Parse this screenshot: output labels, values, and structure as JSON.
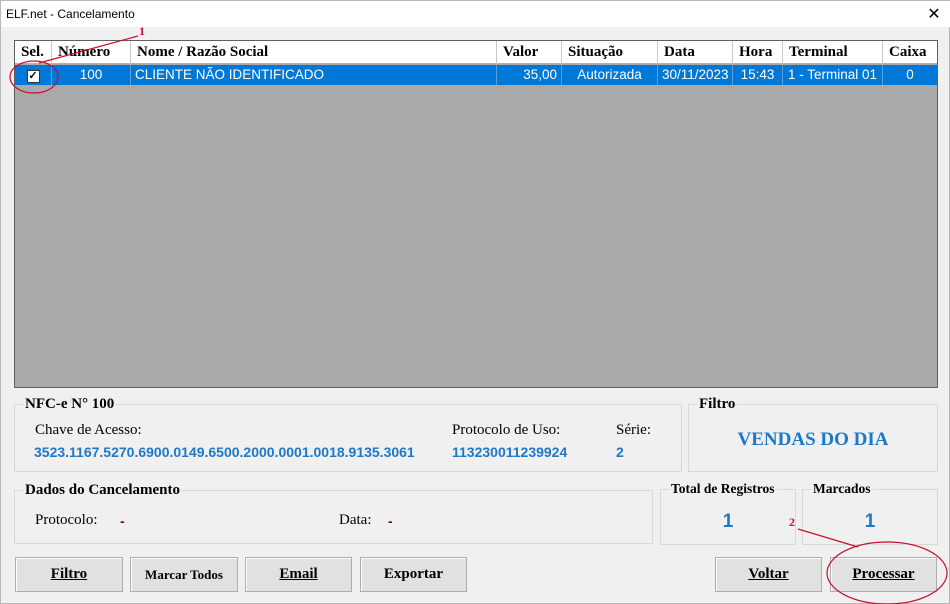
{
  "window": {
    "title": "ELF.net - Cancelamento",
    "close_glyph": "✕"
  },
  "grid": {
    "columns": [
      "Sel.",
      "Número",
      "Nome / Razão Social",
      "Valor",
      "Situação",
      "Data",
      "Hora",
      "Terminal",
      "Caixa"
    ],
    "rows": [
      {
        "selected": true,
        "check_glyph": "✓",
        "numero": "100",
        "nome": "CLIENTE NÃO IDENTIFICADO",
        "valor": "35,00",
        "situacao": "Autorizada",
        "data": "30/11/2023",
        "hora": "15:43",
        "terminal": "1 - Terminal 01",
        "caixa": "0"
      }
    ]
  },
  "nfce": {
    "title": "NFC-e N° 100",
    "chave_label": "Chave de Acesso:",
    "chave_value": "3523.1167.5270.6900.0149.6500.2000.0001.0018.9135.3061",
    "protocolo_label": "Protocolo de Uso:",
    "protocolo_value": "113230011239924",
    "serie_label": "Série:",
    "serie_value": "2"
  },
  "filtro": {
    "title": "Filtro",
    "value": "VENDAS DO DIA"
  },
  "cancelamento": {
    "title": "Dados do Cancelamento",
    "protocolo_label": "Protocolo:",
    "protocolo_value": "-",
    "data_label": "Data:",
    "data_value": "-"
  },
  "totals": {
    "total_label": "Total de Registros",
    "total_value": "1",
    "marcados_label": "Marcados",
    "marcados_value": "1"
  },
  "buttons": {
    "filtro": "Filtro",
    "marcar_todos": "Marcar Todos",
    "email": "Email",
    "exportar": "Exportar",
    "voltar": "Voltar",
    "processar": "Processar"
  },
  "annotations": {
    "marker_1": "1",
    "marker_2": "2",
    "color": "#c8102e"
  },
  "colors": {
    "selection": "#0078d7",
    "grid_bg": "#a9a9a9",
    "value_blue": "#1e78c8",
    "value_red": "#7a0020"
  }
}
